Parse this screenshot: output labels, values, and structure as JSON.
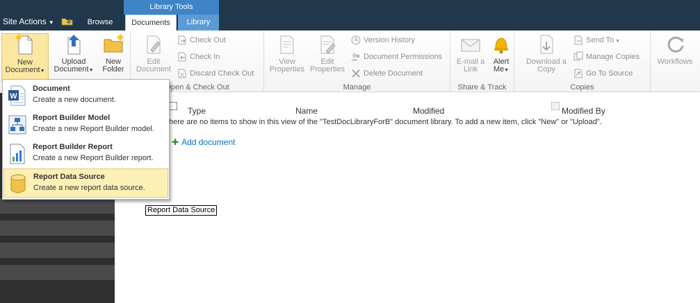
{
  "topbar": {
    "site_actions": "Site Actions",
    "tab_browse": "Browse",
    "contextual_group": "Library Tools",
    "tab_documents": "Documents",
    "tab_library": "Library"
  },
  "ribbon": {
    "new_group": {
      "new_document": [
        "New",
        "Document"
      ],
      "upload_document": [
        "Upload",
        "Document"
      ],
      "new_folder": [
        "New",
        "Folder"
      ]
    },
    "open_checkout": {
      "edit_document": [
        "Edit",
        "Document"
      ],
      "check_out": "Check Out",
      "check_in": "Check In",
      "discard_check_out": "Discard Check Out",
      "label": "Open & Check Out"
    },
    "manage": {
      "view_properties": [
        "View",
        "Properties"
      ],
      "edit_properties": [
        "Edit",
        "Properties"
      ],
      "version_history": "Version History",
      "document_permissions": "Document Permissions",
      "delete_document": "Delete Document",
      "label": "Manage"
    },
    "share_track": {
      "email_link": [
        "E-mail a",
        "Link"
      ],
      "alert_me": [
        "Alert",
        "Me"
      ],
      "label": "Share & Track"
    },
    "copies": {
      "download_copy": [
        "Download a",
        "Copy"
      ],
      "send_to": "Send To",
      "manage_copies": "Manage Copies",
      "go_to_source": "Go To Source",
      "label": "Copies"
    },
    "workflows": {
      "workflows": "Workflows"
    }
  },
  "new_document_menu": [
    {
      "title": "Document",
      "desc": "Create a new document."
    },
    {
      "title": "Report Builder Model",
      "desc": "Create a new Report Builder model."
    },
    {
      "title": "Report Builder Report",
      "desc": "Create a new Report Builder report."
    },
    {
      "title": "Report Data Source",
      "desc": "Create a new report data source."
    }
  ],
  "list": {
    "columns": [
      "Type",
      "Name",
      "Modified",
      "Modified By"
    ],
    "empty_message": "here are no items to show in this view of the \"TestDocLibraryForB\" document library. To add a new item, click \"New\" or \"Upload\".",
    "add_document": "Add document"
  },
  "tooltip": "Report Data Source",
  "colors": {
    "topbar": "#21374c",
    "contextual_tab": "#3e84c6",
    "menu_highlight": "#fcf0b6",
    "link": "#0072c6"
  }
}
